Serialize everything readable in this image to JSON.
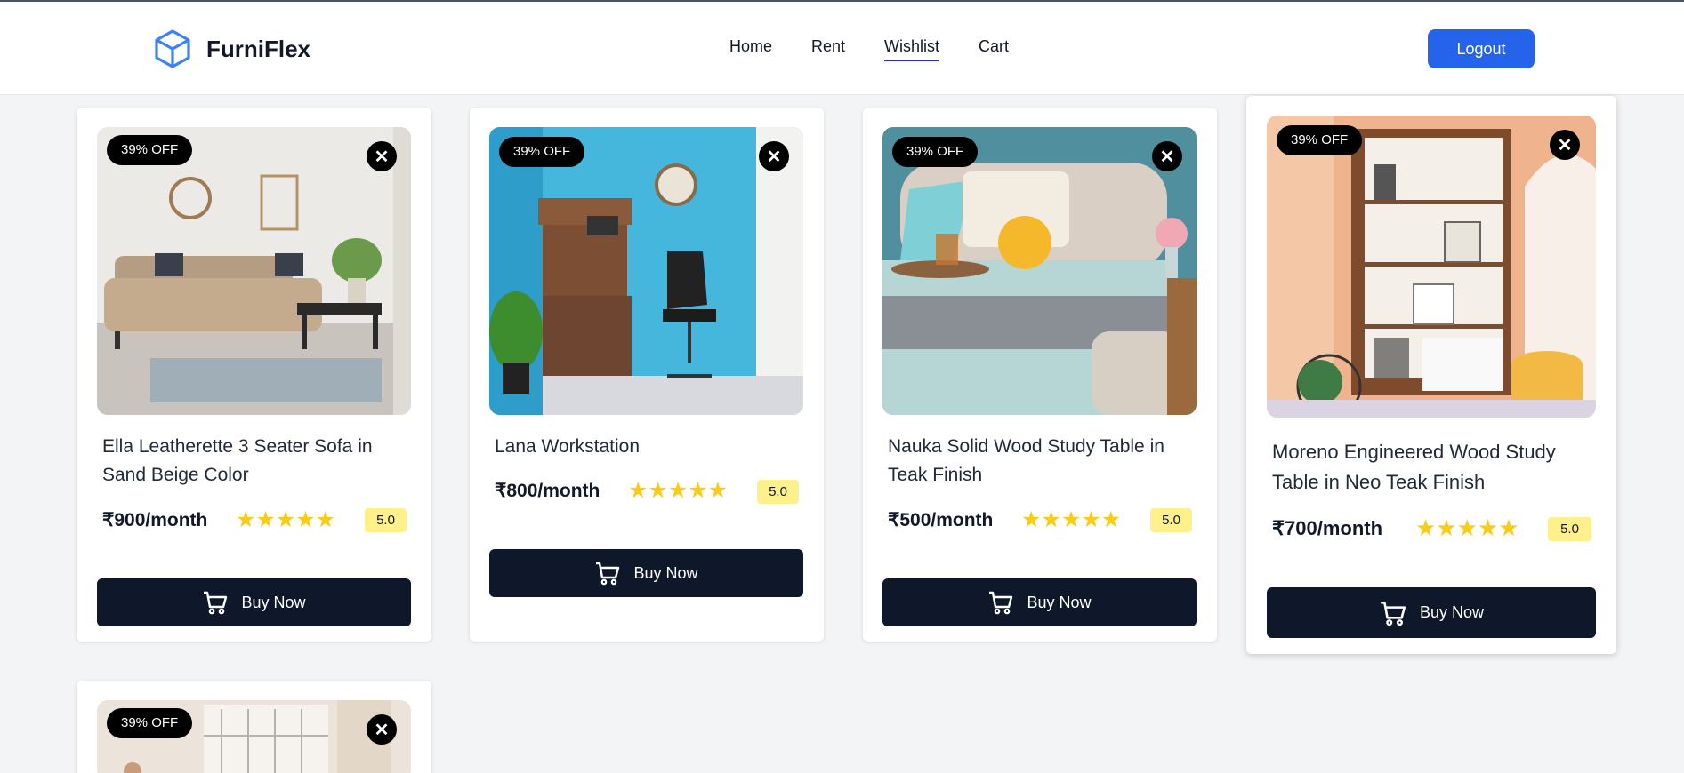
{
  "brand": {
    "name": "FurniFlex",
    "logo_icon": "cube-icon"
  },
  "nav": {
    "items": [
      "Home",
      "Rent",
      "Wishlist",
      "Cart"
    ],
    "active": "Wishlist"
  },
  "logout_label": "Logout",
  "colors": {
    "primary": "#2563eb",
    "dark": "#0f172a",
    "star": "#facc15",
    "rating_bg": "#fef08a",
    "nav_underline": "#1d2ad6"
  },
  "products": [
    {
      "discount": "39% OFF",
      "title": "Ella Leatherette 3 Seater Sofa in Sand Beige Color",
      "price": "₹900/month",
      "stars": "★★★★★",
      "rating": "5.0",
      "buy_label": "Buy Now",
      "remove_label": "✕"
    },
    {
      "discount": "39% OFF",
      "title": "Lana Workstation",
      "price": "₹800/month",
      "stars": "★★★★★",
      "rating": "5.0",
      "buy_label": "Buy Now",
      "remove_label": "✕"
    },
    {
      "discount": "39% OFF",
      "title": "Nauka Solid Wood Study Table in Teak Finish",
      "price": "₹500/month",
      "stars": "★★★★★",
      "rating": "5.0",
      "buy_label": "Buy Now",
      "remove_label": "✕"
    },
    {
      "discount": "39% OFF",
      "title": "Moreno Engineered Wood Study Table in Neo Teak Finish",
      "price": "₹700/month",
      "stars": "★★★★★",
      "rating": "5.0",
      "buy_label": "Buy Now",
      "remove_label": "✕"
    },
    {
      "discount": "39% OFF",
      "remove_label": "✕"
    }
  ]
}
